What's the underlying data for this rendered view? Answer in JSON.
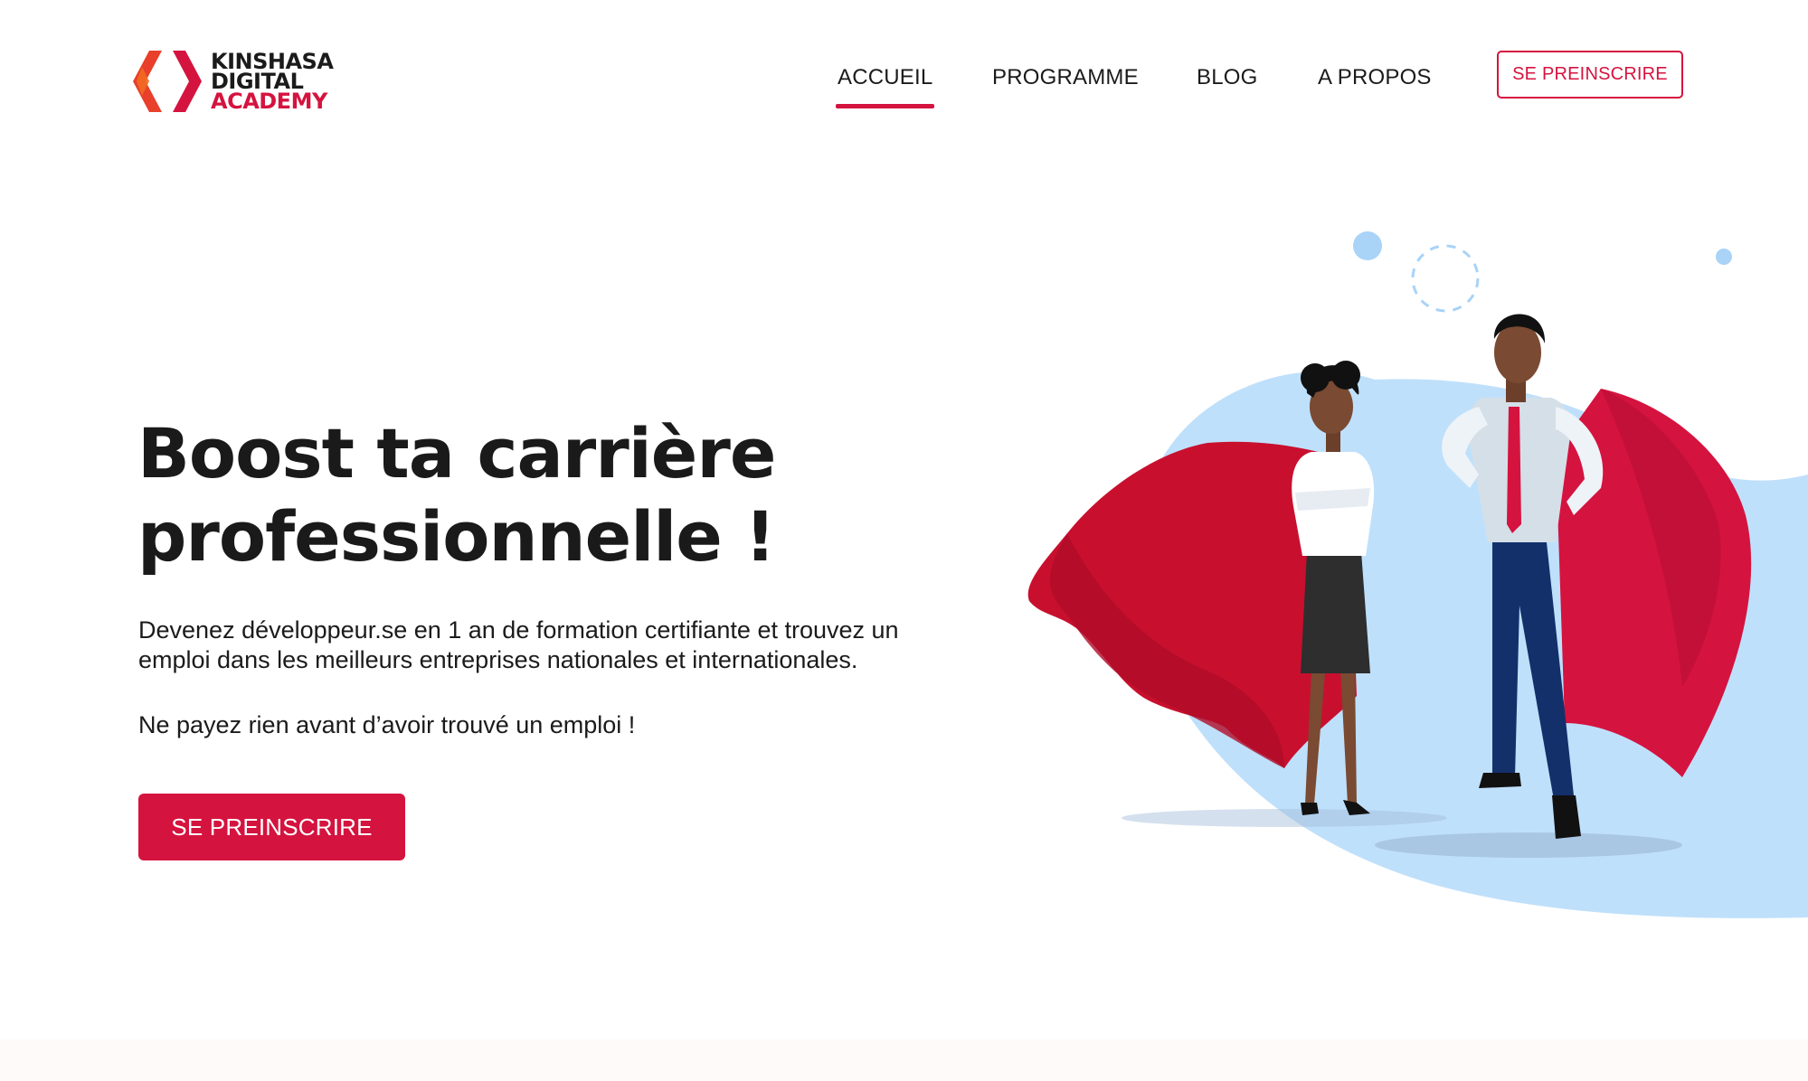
{
  "logo": {
    "line1": "KINSHASA",
    "line2": "DIGITAL",
    "line3": "ACADEMY"
  },
  "nav": {
    "items": [
      {
        "label": "ACCUEIL",
        "active": true
      },
      {
        "label": "PROGRAMME",
        "active": false
      },
      {
        "label": "BLOG",
        "active": false
      },
      {
        "label": "A PROPOS",
        "active": false
      }
    ],
    "cta_label": "SE PREINSCRIRE"
  },
  "hero": {
    "title_line1": "Boost ta carrière",
    "title_line2": "professionnelle !",
    "description": "Devenez développeur.se en 1 an de formation certifiante et trouvez un emploi dans les meilleurs entreprises nationales et internationales.",
    "note": "Ne payez rien avant d’avoir trouvé un emploi !",
    "cta_label": "SE PREINSCRIRE"
  },
  "colors": {
    "accent": "#d5133f",
    "blob": "#bfe0fb",
    "cape": "#c8102e",
    "text": "#1b1b1b"
  }
}
